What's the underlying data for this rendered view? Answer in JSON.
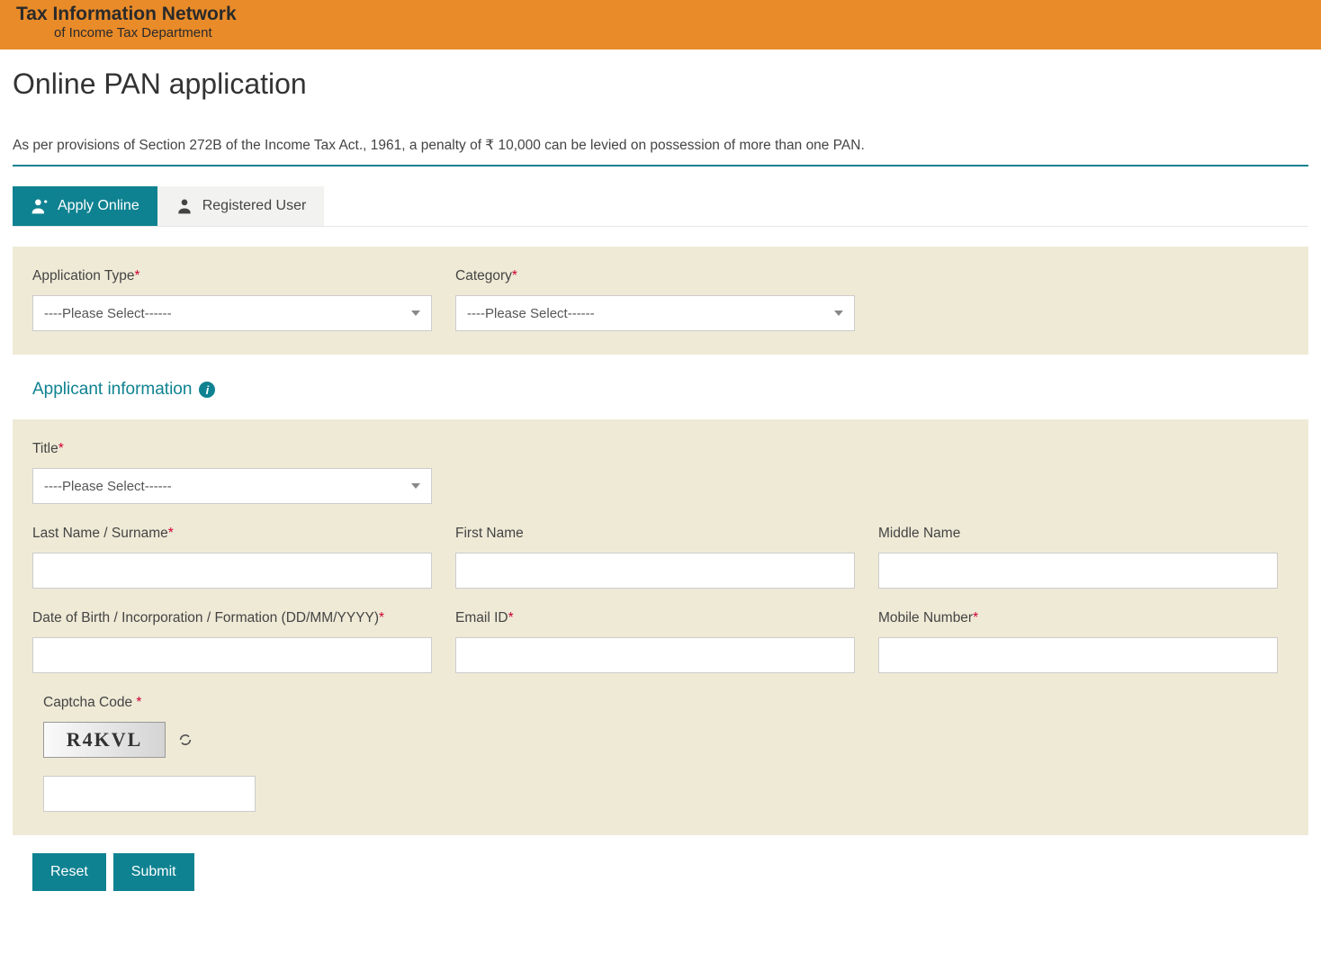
{
  "banner": {
    "title": "Tax Information Network",
    "subtitle": "of Income Tax Department"
  },
  "page": {
    "title": "Online PAN application"
  },
  "notice": "As per provisions of Section 272B of the Income Tax Act., 1961, a penalty of ₹ 10,000 can be levied on possession of more than one PAN.",
  "tabs": {
    "apply": "Apply Online",
    "registered": "Registered User"
  },
  "labels": {
    "application_type": "Application Type",
    "category": "Category",
    "section": "Applicant information",
    "title": "Title",
    "last_name": "Last Name / Surname",
    "first_name": "First Name",
    "middle_name": "Middle Name",
    "dob": "Date of Birth / Incorporation / Formation (DD/MM/YYYY)",
    "email": "Email ID",
    "mobile": "Mobile Number",
    "captcha": "Captcha Code"
  },
  "selects": {
    "placeholder": "----Please Select------"
  },
  "captcha": {
    "value": "R4KVL"
  },
  "buttons": {
    "reset": "Reset",
    "submit": "Submit"
  }
}
